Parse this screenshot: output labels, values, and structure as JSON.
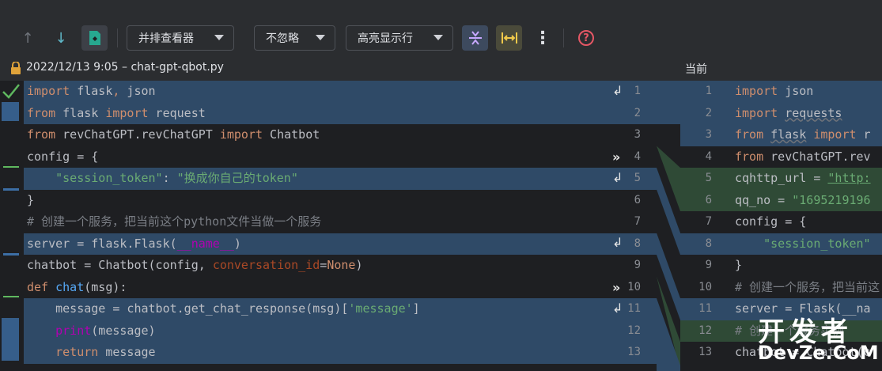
{
  "toolbar": {
    "prev_icon": "↑",
    "next_icon": "↓",
    "view_mode_label": "并排查看器",
    "ignore_label": "不忽略",
    "highlight_label": "高亮显示行",
    "more_icon": "⋮",
    "help_icon": "?"
  },
  "header": {
    "left_title": "2022/12/13 9:05 – chat-gpt-qbot.py",
    "right_title": "当前"
  },
  "left_lines": [
    {
      "num": "1",
      "text": "import flask, json"
    },
    {
      "num": "2",
      "text": "from flask import request"
    },
    {
      "num": "3",
      "text": "from revChatGPT.revChatGPT import Chatbot"
    },
    {
      "num": "4",
      "text": "config = {"
    },
    {
      "num": "5",
      "text": "    \"session_token\": \"换成你自己的token\""
    },
    {
      "num": "6",
      "text": "}"
    },
    {
      "num": "7",
      "text": "# 创建一个服务，把当前这个python文件当做一个服务"
    },
    {
      "num": "8",
      "text": "server = flask.Flask(__name__)"
    },
    {
      "num": "9",
      "text": "chatbot = Chatbot(config, conversation_id=None)"
    },
    {
      "num": "10",
      "text": "def chat(msg):"
    },
    {
      "num": "11",
      "text": "    message = chatbot.get_chat_response(msg)['message']"
    },
    {
      "num": "12",
      "text": "    print(message)"
    },
    {
      "num": "13",
      "text": "    return message"
    }
  ],
  "right_lines": [
    {
      "num": "1",
      "text": "import json"
    },
    {
      "num": "2",
      "text": "import requests"
    },
    {
      "num": "3",
      "text": "from flask import r"
    },
    {
      "num": "4",
      "text": "from revChatGPT.rev"
    },
    {
      "num": "5",
      "text": "cqhttp_url = \"http:"
    },
    {
      "num": "6",
      "text": "qq_no = \"1695219196"
    },
    {
      "num": "7",
      "text": "config = {"
    },
    {
      "num": "8",
      "text": "    \"session_token\""
    },
    {
      "num": "9",
      "text": "}"
    },
    {
      "num": "10",
      "text": "# 创建一个服务，把当前这"
    },
    {
      "num": "11",
      "text": "server = Flask(__na"
    },
    {
      "num": "12",
      "text": "# 创建一个服务实例"
    },
    {
      "num": "13",
      "text": "chatbot = Chatbot(c"
    }
  ],
  "watermark": {
    "line1": "开发者",
    "line2": "DevZe.CoM"
  },
  "colors": {
    "changed": "#2f4a67",
    "added": "#2f4a36",
    "accent_orange": "#cf8e6d",
    "string_green": "#6aab73",
    "help_red": "#e55765"
  }
}
